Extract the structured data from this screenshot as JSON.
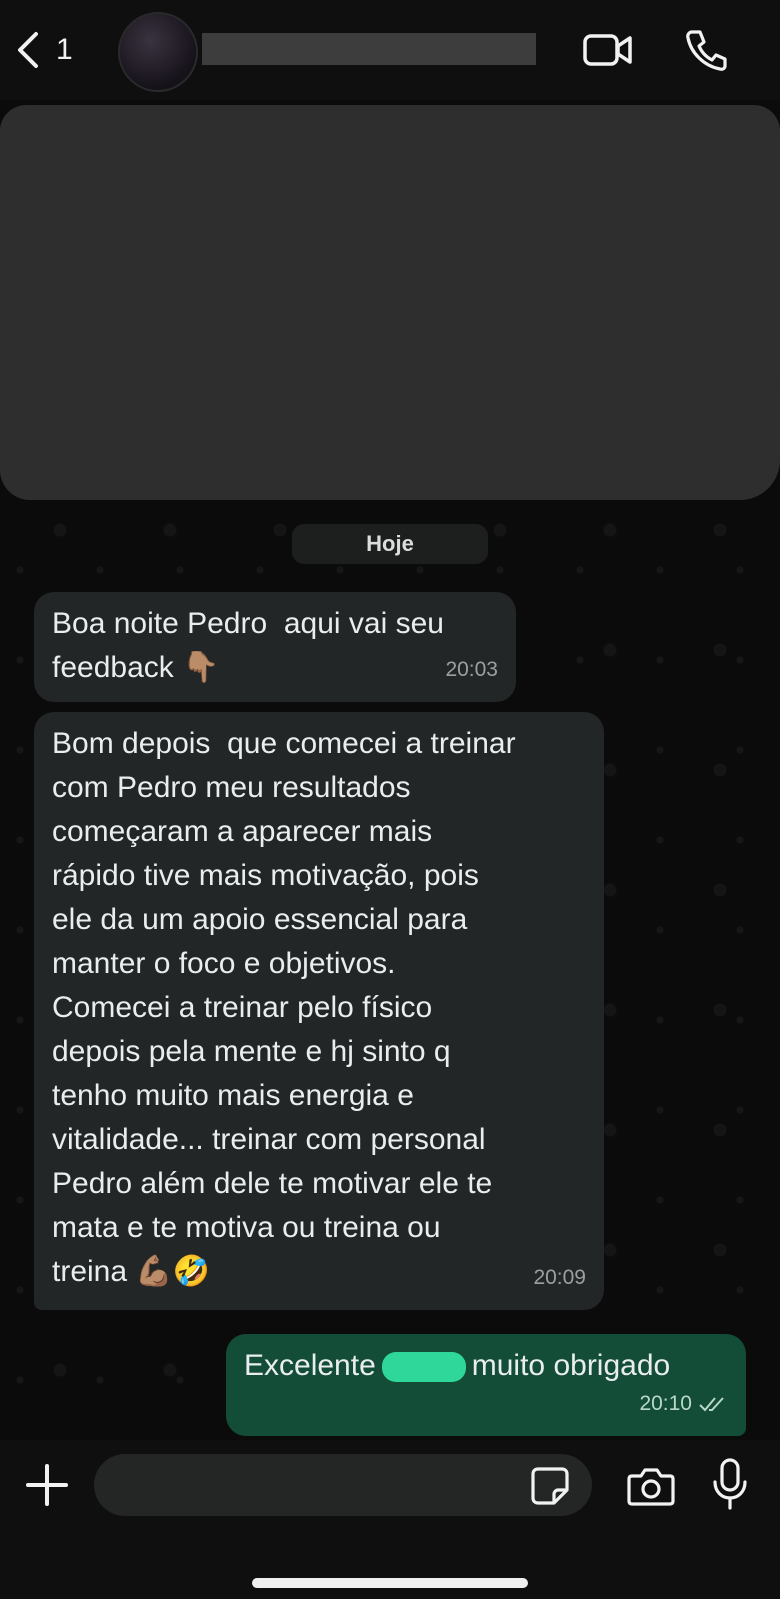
{
  "header": {
    "back_count": "1",
    "contact_name": ""
  },
  "date_separator": "Hoje",
  "messages": [
    {
      "direction": "incoming",
      "text": "Boa noite Pedro  aqui vai seu\nfeedback 👇🏽",
      "time": "20:03"
    },
    {
      "direction": "incoming",
      "text": "Bom depois  que comecei a treinar\ncom Pedro meu resultados\ncomeçaram a aparecer mais\nrápido tive mais motivação, pois\nele da um apoio essencial para\nmanter o foco e objetivos.\nComecei a treinar pelo físico\ndepois pela mente e hj sinto q\ntenho muito mais energia e\nvitalidade... treinar com personal\nPedro além dele te motivar ele te\nmata e te motiva ou treina ou\ntreina 💪🏽🤣",
      "time": "20:09"
    },
    {
      "direction": "outgoing",
      "text_before": "Excelente",
      "text_after": "muito obrigado",
      "time": "20:10",
      "status": "read"
    }
  ],
  "input": {
    "placeholder": ""
  },
  "colors": {
    "incoming_bubble": "#232626",
    "outgoing_bubble": "#134d37",
    "background": "#0b0b0b"
  },
  "icons": [
    "back-chevron-icon",
    "video-call-icon",
    "phone-icon",
    "plus-icon",
    "sticker-icon",
    "camera-icon",
    "microphone-icon",
    "double-check-icon"
  ]
}
